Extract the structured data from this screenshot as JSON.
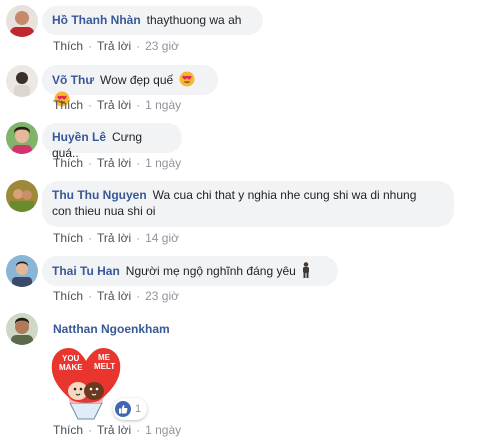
{
  "actions": {
    "like": "Thích",
    "reply": "Trả lời",
    "separator": "·"
  },
  "comments": [
    {
      "author": "Hồ Thanh Nhàn",
      "text": "thaythuong wa ah",
      "time": "23 giờ"
    },
    {
      "author": "Võ Thư",
      "text": "Wow đẹp quế",
      "time": "1 ngày"
    },
    {
      "author": "Huyền Lê",
      "text": "Cưng quá..",
      "time": "1 ngày"
    },
    {
      "author": "Thu Thu Nguyen",
      "text": "Wa cua chi that y nghia nhe cung shi wa di nhung",
      "text2": "con thieu nua shi oi",
      "time": "14 giờ"
    },
    {
      "author": "Thai Tu Han",
      "text": "Người mẹ ngộ nghĩnh đáng yêu",
      "time": "23 giờ"
    },
    {
      "author": "Natthan Ngoenkham",
      "text": "",
      "time": "1 ngày"
    }
  ],
  "sticker": {
    "line1": "YOU",
    "line2": "MAKE",
    "line3": "ME",
    "line4": "MELT"
  },
  "reaction": {
    "icon": "like-icon",
    "count": "1"
  }
}
